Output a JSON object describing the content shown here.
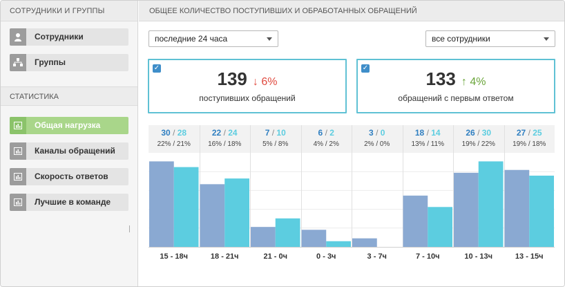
{
  "sidebar": {
    "header": "Сотрудники и группы",
    "items_top": [
      {
        "label": "Сотрудники",
        "icon": "person-icon"
      },
      {
        "label": "Группы",
        "icon": "group-icon"
      }
    ],
    "section_title": "Статистика",
    "items_stats": [
      {
        "label": "Общая нагрузка",
        "icon": "bar-chart-icon",
        "active": true
      },
      {
        "label": "Каналы обращений",
        "icon": "bar-chart-icon",
        "active": false
      },
      {
        "label": "Скорость ответов",
        "icon": "bar-chart-icon",
        "active": false
      },
      {
        "label": "Лучшие в команде",
        "icon": "bar-chart-icon",
        "active": false
      }
    ]
  },
  "main": {
    "header": "Общее количество поступивших и обработанных обращений",
    "period_select": "последние 24 часа",
    "staff_select": "все сотрудники",
    "cards": [
      {
        "value": "139",
        "trend": "6%",
        "direction": "down",
        "label": "поступивших обращений"
      },
      {
        "value": "133",
        "trend": "4%",
        "direction": "up",
        "label": "обращений с первым ответом"
      }
    ]
  },
  "colors": {
    "accent": "#5fc1d4",
    "series_incoming": "#8aa9d2",
    "series_answered": "#5ccde0",
    "active_item": "#a9d68a",
    "trend_down": "#e04a3f",
    "trend_up": "#6aa53a",
    "value_link": "#2f7fc1"
  },
  "chart_data": {
    "type": "bar",
    "categories": [
      "15 - 18ч",
      "18 - 21ч",
      "21 - 0ч",
      "0 - 3ч",
      "3 - 7ч",
      "7 - 10ч",
      "10 - 13ч",
      "13 - 15ч"
    ],
    "series": [
      {
        "values": [
          30,
          22,
          7,
          6,
          3,
          18,
          26,
          27
        ]
      },
      {
        "values": [
          28,
          24,
          10,
          2,
          0,
          14,
          30,
          25
        ]
      }
    ],
    "percent_labels": [
      [
        "22%",
        "21%"
      ],
      [
        "16%",
        "18%"
      ],
      [
        "5%",
        "8%"
      ],
      [
        "4%",
        "2%"
      ],
      [
        "2%",
        "0%"
      ],
      [
        "13%",
        "11%"
      ],
      [
        "19%",
        "22%"
      ],
      [
        "19%",
        "18%"
      ]
    ],
    "ylim": [
      0,
      33
    ]
  }
}
